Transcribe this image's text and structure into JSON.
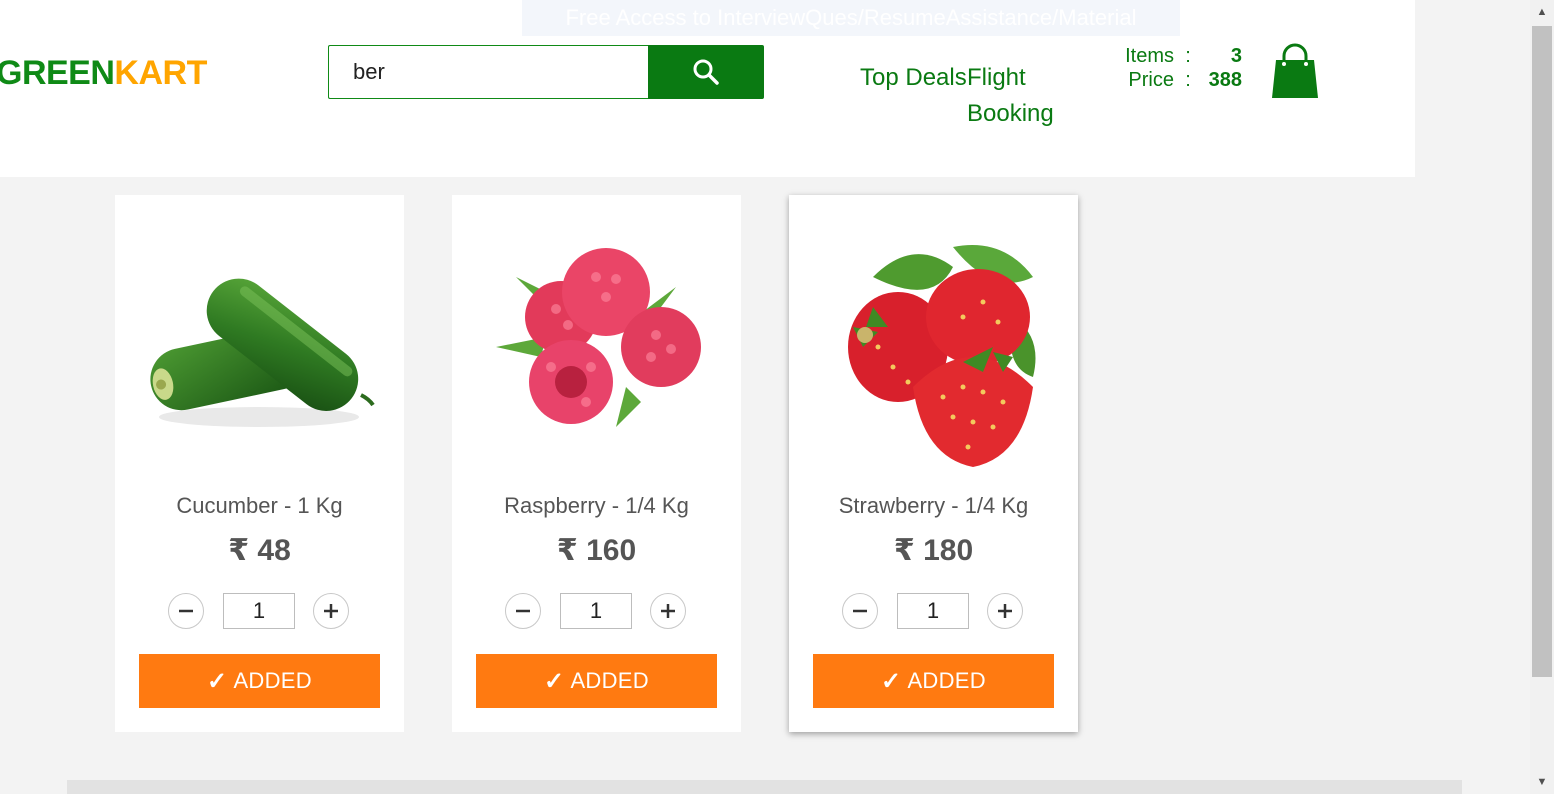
{
  "banner": {
    "text": "Free Access to InterviewQues/ResumeAssistance/Material"
  },
  "logo": {
    "part1": "GREEN",
    "part2": "KART"
  },
  "search": {
    "value": "ber",
    "button_icon": "search-icon"
  },
  "nav": {
    "top_deals": "Top Deals",
    "flight_booking": "Flight Booking"
  },
  "cart": {
    "items_label": "Items",
    "items_value": "3",
    "price_label": "Price",
    "price_value": "388",
    "separator": ":",
    "icon": "shopping-bag-icon"
  },
  "products": [
    {
      "name": "Cucumber - 1 Kg",
      "price": "₹ 48",
      "qty": "1",
      "button": "ADDED",
      "check": "✓",
      "image": "cucumber-image"
    },
    {
      "name": "Raspberry - 1/4 Kg",
      "price": "₹ 160",
      "qty": "1",
      "button": "ADDED",
      "check": "✓",
      "image": "raspberry-image"
    },
    {
      "name": "Strawberry - 1/4 Kg",
      "price": "₹ 180",
      "qty": "1",
      "button": "ADDED",
      "check": "✓",
      "image": "strawberry-image"
    }
  ],
  "colors": {
    "brand_green": "#0a7a12",
    "brand_orange": "#ffa500",
    "button_orange": "#ff7a11"
  }
}
